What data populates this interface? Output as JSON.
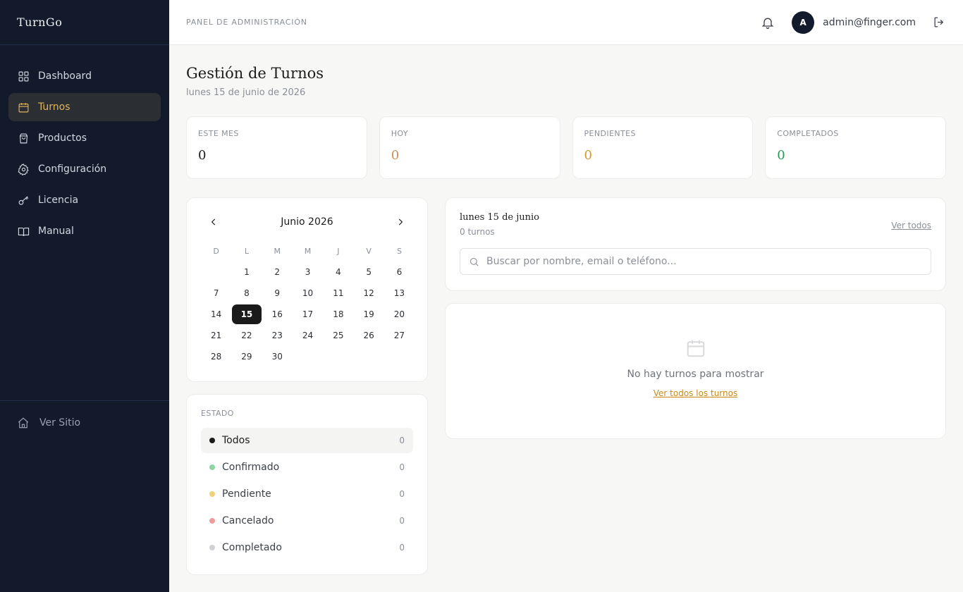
{
  "brand": "TurnGo",
  "sidebar": {
    "items": [
      {
        "label": "Dashboard",
        "icon": "grid-icon"
      },
      {
        "label": "Turnos",
        "icon": "calendar-icon",
        "active": true
      },
      {
        "label": "Productos",
        "icon": "bag-icon"
      },
      {
        "label": "Configuración",
        "icon": "gear-icon"
      },
      {
        "label": "Licencia",
        "icon": "key-icon"
      },
      {
        "label": "Manual",
        "icon": "book-icon"
      }
    ],
    "visit_site": "Ver Sitio"
  },
  "header": {
    "title": "PANEL DE ADMINISTRACIÓN",
    "avatar_initial": "A",
    "email": "admin@finger.com"
  },
  "page": {
    "title": "Gestión de Turnos",
    "date": "lunes 15 de junio de 2026"
  },
  "stats": [
    {
      "label": "ESTE MES",
      "value": "0",
      "color": "#1c1c1c"
    },
    {
      "label": "HOY",
      "value": "0",
      "color": "#c7935a"
    },
    {
      "label": "PENDIENTES",
      "value": "0",
      "color": "#d59a2a"
    },
    {
      "label": "COMPLETADOS",
      "value": "0",
      "color": "#1f9d55"
    }
  ],
  "calendar": {
    "month": "Junio 2026",
    "weekdays": [
      "D",
      "L",
      "M",
      "M",
      "J",
      "V",
      "S"
    ],
    "leading_blanks": 1,
    "days_in_month": 30,
    "selected_day": 15
  },
  "estado": {
    "title": "ESTADO",
    "items": [
      {
        "label": "Todos",
        "count": "0",
        "color": "#1a1a1a",
        "active": true
      },
      {
        "label": "Confirmado",
        "count": "0",
        "color": "#8fd6a4"
      },
      {
        "label": "Pendiente",
        "count": "0",
        "color": "#f0d27a"
      },
      {
        "label": "Cancelado",
        "count": "0",
        "color": "#f09a9a"
      },
      {
        "label": "Completado",
        "count": "0",
        "color": "#cfd1d6"
      }
    ]
  },
  "list": {
    "date": "lunes 15 de junio",
    "count": "0 turnos",
    "view_all": "Ver todos",
    "search_placeholder": "Buscar por nombre, email o teléfono..."
  },
  "empty": {
    "message": "No hay turnos para mostrar",
    "link": "Ver todos los turnos"
  }
}
